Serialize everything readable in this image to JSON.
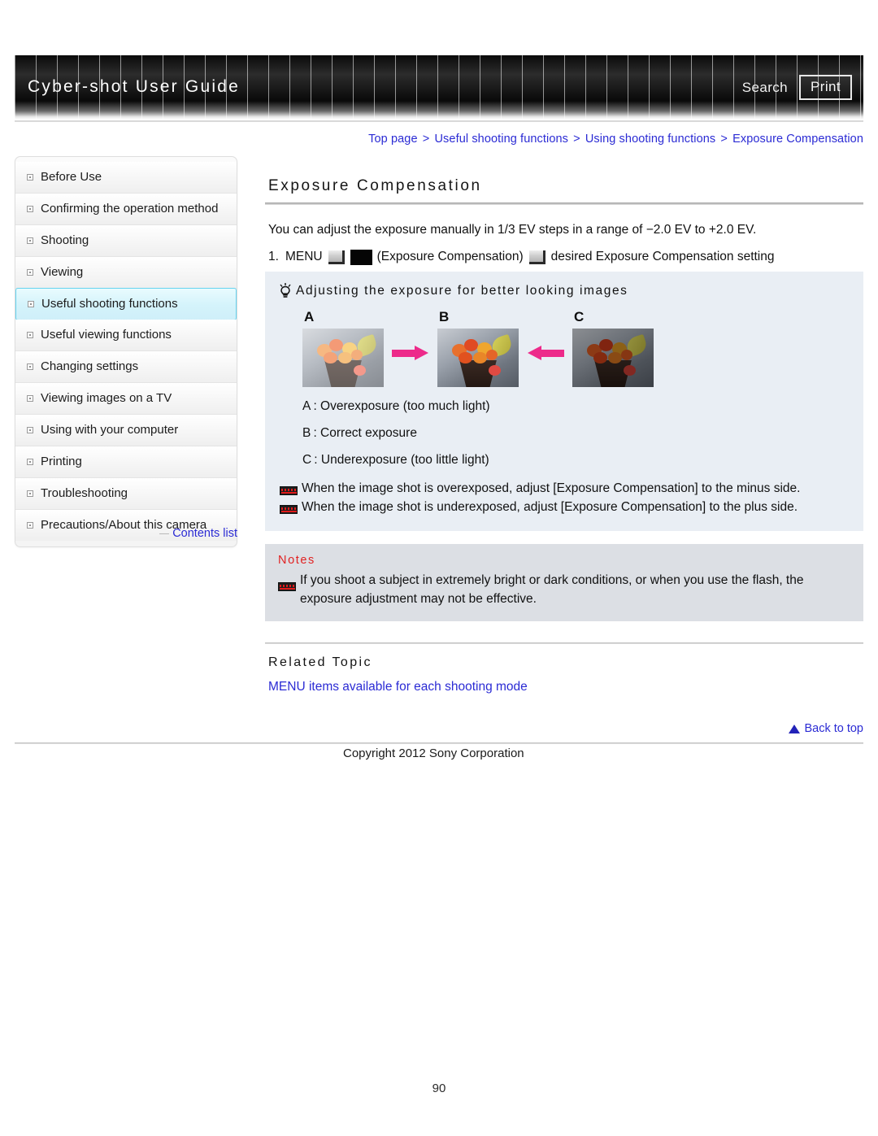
{
  "header": {
    "title": "Cyber-shot User Guide",
    "search_label": "Search",
    "print_label": "Print"
  },
  "breadcrumb": {
    "items": [
      "Top page",
      "Useful shooting functions",
      "Using shooting functions",
      "Exposure Compensation"
    ],
    "separator": ">"
  },
  "sidebar": {
    "items": [
      {
        "label": "Before Use",
        "active": false
      },
      {
        "label": "Confirming the operation method",
        "active": false
      },
      {
        "label": "Shooting",
        "active": false
      },
      {
        "label": "Viewing",
        "active": false
      },
      {
        "label": "Useful shooting functions",
        "active": true
      },
      {
        "label": "Useful viewing functions",
        "active": false
      },
      {
        "label": "Changing settings",
        "active": false
      },
      {
        "label": "Viewing images on a TV",
        "active": false
      },
      {
        "label": "Using with your computer",
        "active": false
      },
      {
        "label": "Printing",
        "active": false
      },
      {
        "label": "Troubleshooting",
        "active": false
      },
      {
        "label": "Precautions/About this camera",
        "active": false
      }
    ],
    "contents_list_label": "Contents list"
  },
  "main": {
    "title": "Exposure Compensation",
    "intro": "You can adjust the exposure manually in 1/3 EV steps in a range of −2.0 EV to +2.0 EV.",
    "step": {
      "number": "1.",
      "part1": "MENU",
      "part2": "(Exposure Compensation)",
      "part3": "desired Exposure Compensation setting"
    },
    "tip": {
      "heading": "Adjusting the exposure for better looking images",
      "figure_labels": [
        "A",
        "B",
        "C"
      ],
      "legend": [
        "A : Overexposure (too much light)",
        "B : Correct exposure",
        "C : Underexposure (too little light)"
      ],
      "bullets": [
        "When the image shot is overexposed, adjust [Exposure Compensation] to the minus side.",
        "When the image shot is underexposed, adjust [Exposure Compensation] to the plus side."
      ]
    },
    "notes": {
      "heading": "Notes",
      "items": [
        "If you shoot a subject in extremely bright or dark conditions, or when you use the flash, the exposure adjustment may not be effective."
      ]
    },
    "related": {
      "heading": "Related Topic",
      "links": [
        "MENU items available for each shooting mode"
      ]
    },
    "back_to_top_label": "Back to top"
  },
  "footer": {
    "copyright": "Copyright 2012 Sony Corporation",
    "page_number": "90"
  },
  "colors": {
    "link_blue": "#2b2bd4",
    "highlight_cyan": "#d4f3fb",
    "notes_red": "#e12222",
    "arrow_pink": "#ed2a8a"
  }
}
